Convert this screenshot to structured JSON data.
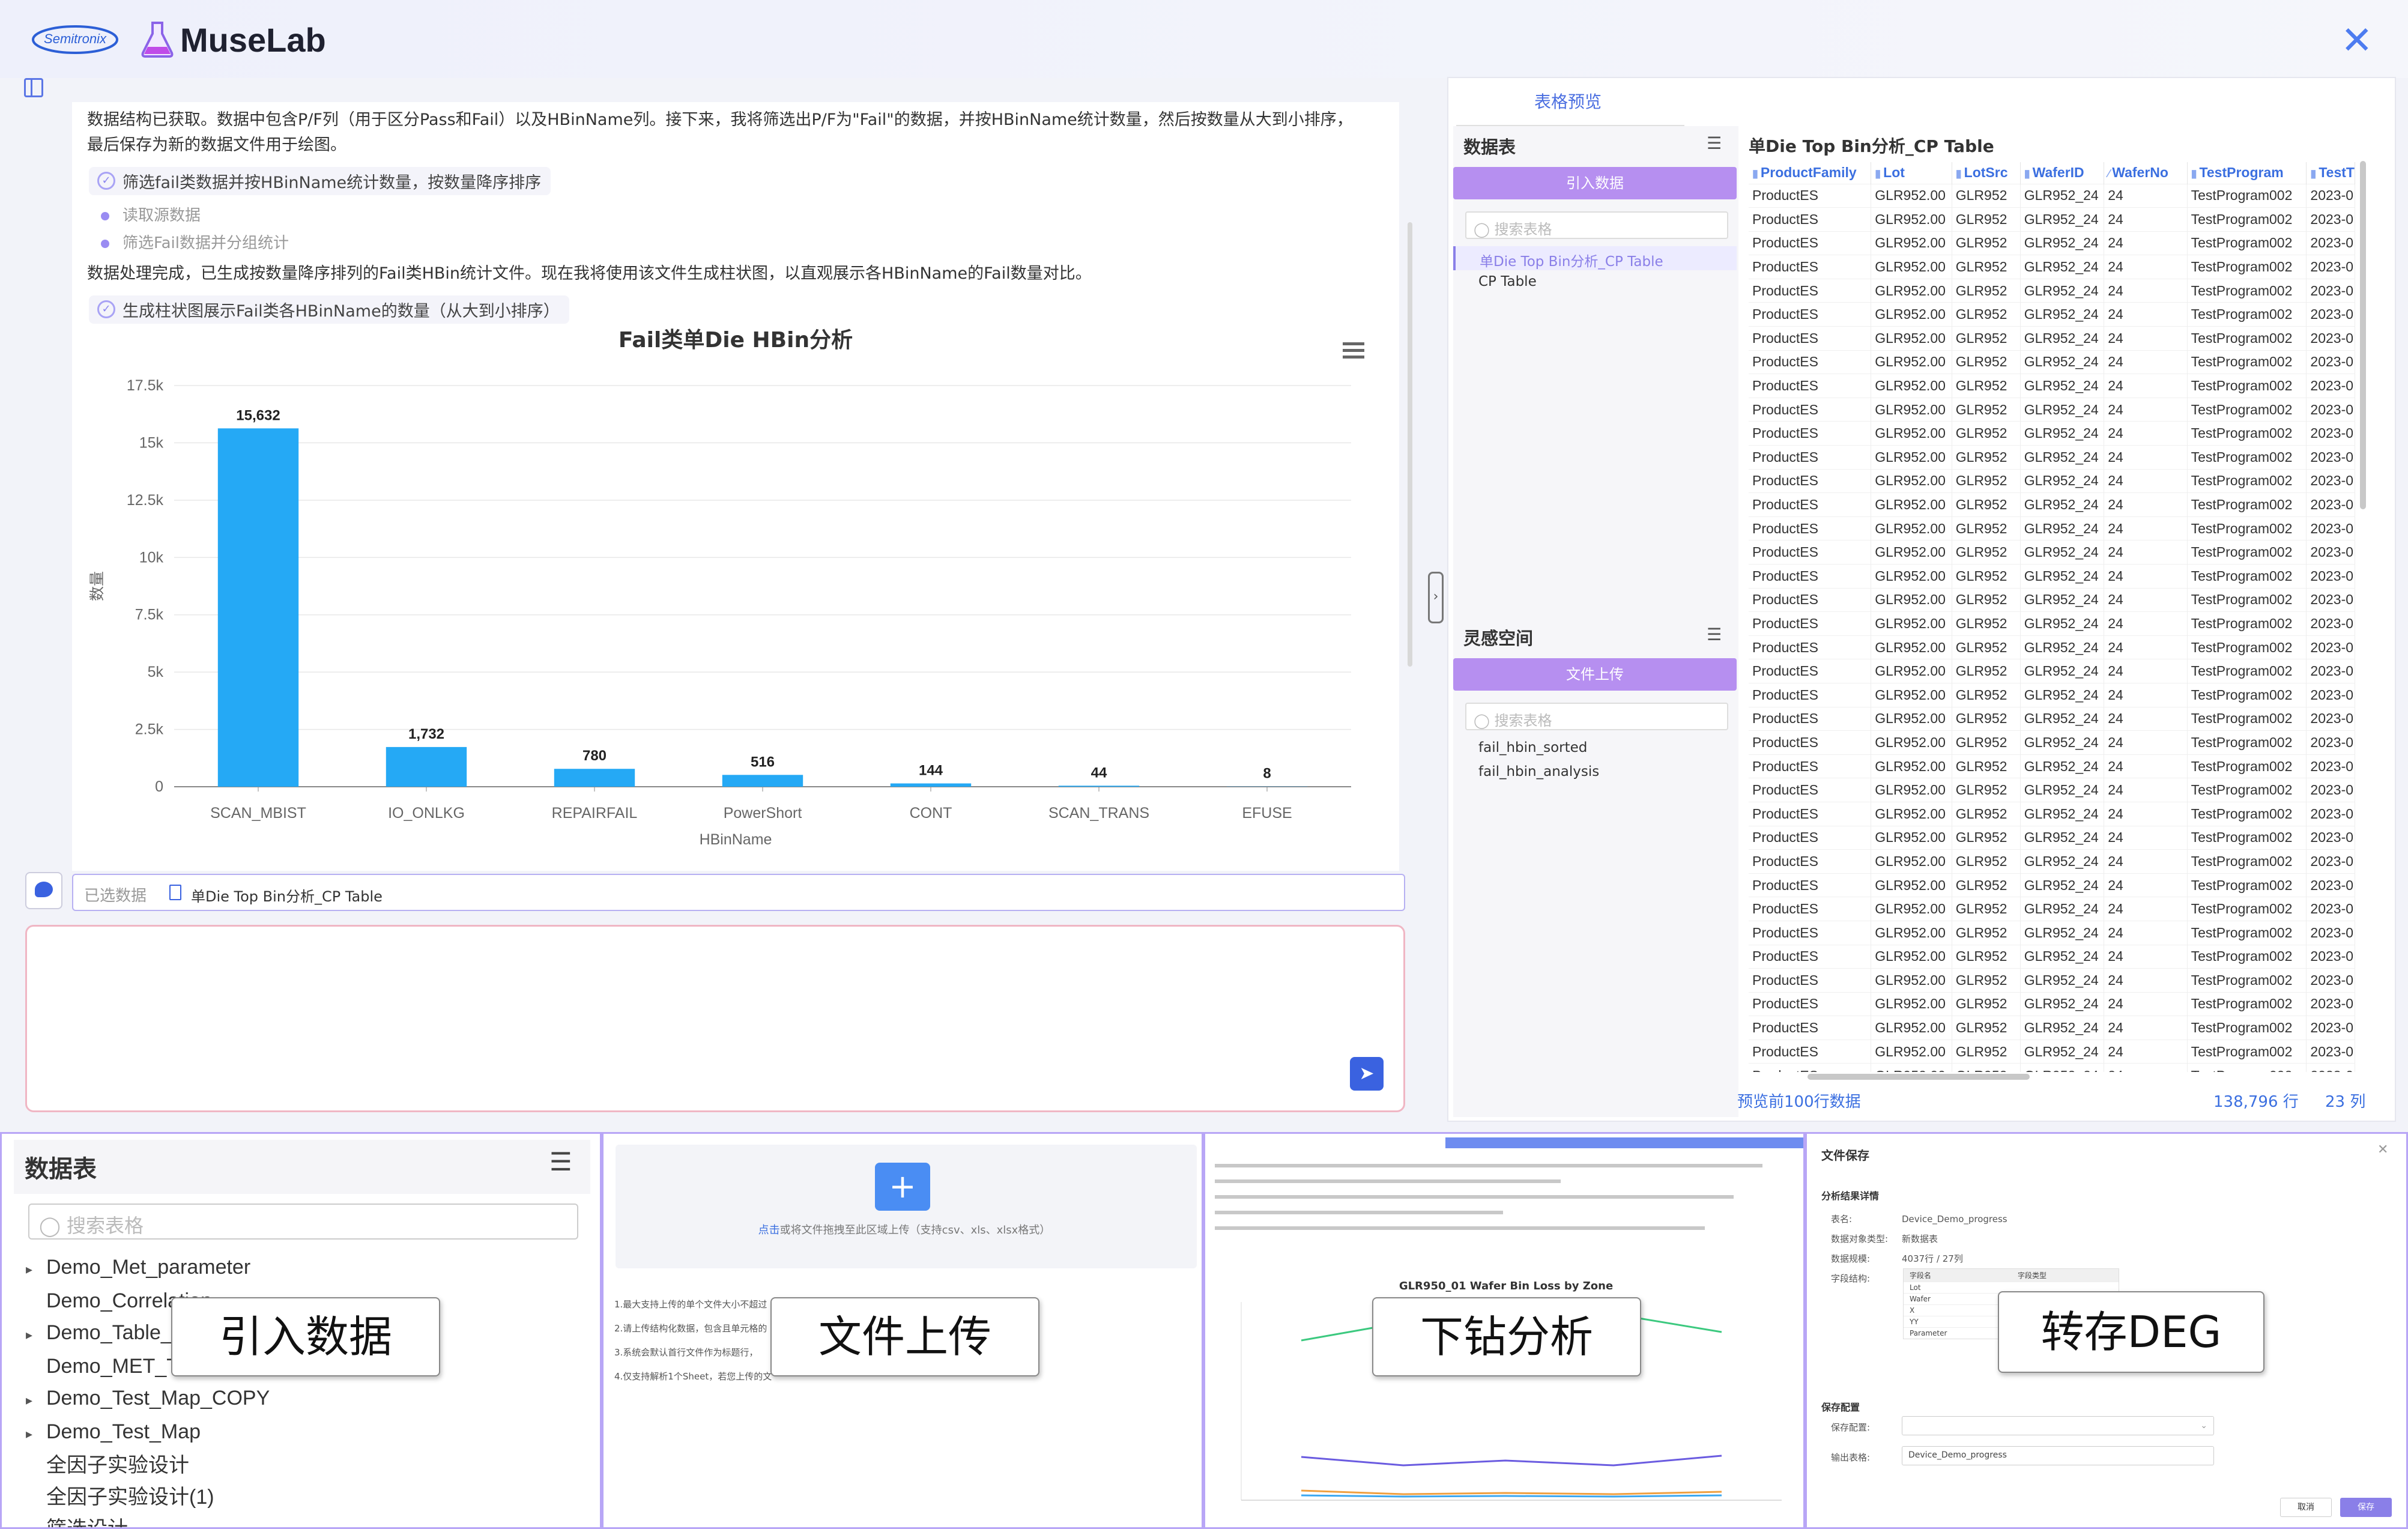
{
  "app": {
    "brand": "Semitronix",
    "name": "MuseLab"
  },
  "chat": {
    "message1": "数据结构已获取。数据中包含P/F列（用于区分Pass和Fail）以及HBinName列。接下来，我将筛选出P/F为\"Fail\"的数据，并按HBinName统计数量，然后按数量从大到小排序，",
    "message1b": "最后保存为新的数据文件用于绘图。",
    "step1": "筛选fail类数据并按HBinName统计数量，按数量降序排序",
    "sub1": "读取源数据",
    "sub2": "筛选Fail数据并分组统计",
    "message2": "数据处理完成，已生成按数量降序排列的Fail类HBin统计文件。现在我将使用该文件生成柱状图，以直观展示各HBinName的Fail数量对比。",
    "step2": "生成柱状图展示Fail类各HBinName的数量（从大到小排序）",
    "selected_label": "已选数据",
    "selected_item": "单Die Top Bin分析_CP Table"
  },
  "chart_data": {
    "type": "bar",
    "title": "Fail类单Die HBin分析",
    "xlabel": "HBinName",
    "ylabel": "数量",
    "categories": [
      "SCAN_MBIST",
      "IO_ONLKG",
      "REPAIRFAIL",
      "PowerShort",
      "CONT",
      "SCAN_TRANS",
      "EFUSE"
    ],
    "values": [
      15632,
      1732,
      780,
      516,
      144,
      44,
      8
    ],
    "data_labels": [
      "15,632",
      "1,732",
      "780",
      "516",
      "144",
      "44",
      "8"
    ],
    "ylim": [
      0,
      17500
    ],
    "yticks": [
      "0",
      "2.5k",
      "5k",
      "7.5k",
      "10k",
      "12.5k",
      "15k",
      "17.5k"
    ],
    "grid": true,
    "color": "#25a9f5"
  },
  "right": {
    "tab": "表格预览",
    "data_section": "数据表",
    "import_btn": "引入数据",
    "search_placeholder": "搜索表格",
    "tables": [
      "单Die Top Bin分析_CP Table",
      "CP Table"
    ],
    "inspiration": "灵感空间",
    "upload_btn": "文件上传",
    "files": [
      "fail_hbin_sorted",
      "fail_hbin_analysis"
    ],
    "table_title": "单Die Top Bin分析_CP Table",
    "columns": [
      "ProductFamily",
      "Lot",
      "LotSrc",
      "WaferID",
      "WaferNo",
      "TestProgram",
      "TestT"
    ],
    "row": [
      "ProductES",
      "GLR952.00",
      "GLR952",
      "GLR952_24",
      "24",
      "TestProgram002",
      "2023-0"
    ],
    "footer_left": "预览前100行数据",
    "footer_rows": "138,796 行",
    "footer_cols": "23 列"
  },
  "bottom": {
    "panel1": {
      "title": "数据表",
      "search": "搜索表格",
      "items": [
        "Demo_Met_parameter",
        "Demo_Correlation",
        "Demo_Table_o",
        "Demo_MET_Ta",
        "Demo_Test_Map_COPY",
        "Demo_Test_Map",
        "全因子实验设计",
        "全因子实验设计(1)",
        "筛选设计"
      ],
      "label": "引入数据"
    },
    "panel2": {
      "upload_hint_link": "点击",
      "upload_hint": "或将文件拖拽至此区域上传（支持csv、xls、xlsx格式）",
      "notes": [
        "1.最大支持上传的单个文件大小不超过",
        "2.请上传结构化数据，包含且单元格的",
        "3.系统会默认首行文件作为标题行，",
        "4.仅支持解析1个Sheet，若您上传的文"
      ],
      "label": "文件上传"
    },
    "panel3": {
      "chart_title": "GLR950_01 Wafer Bin Loss by Zone",
      "label": "下钻分析"
    },
    "panel4": {
      "title": "文件保存",
      "section1": "分析结果详情",
      "fields": [
        {
          "k": "表名:",
          "v": "Device_Demo_progress"
        },
        {
          "k": "数据对象类型:",
          "v": "新数据表"
        },
        {
          "k": "数据规模:",
          "v": "4037行 / 27列"
        },
        {
          "k": "字段结构:",
          "v": ""
        }
      ],
      "field_cols": [
        "字段名",
        "字段类型"
      ],
      "field_rows": [
        "Lot",
        "Wafer",
        "X",
        "YY",
        "Parameter"
      ],
      "section2": "保存配置",
      "save_cfg": "保存配置:",
      "out_table": "输出表格:",
      "out_value": "Device_Demo_progress",
      "cancel": "取消",
      "save": "保存",
      "label": "转存DEG"
    }
  }
}
